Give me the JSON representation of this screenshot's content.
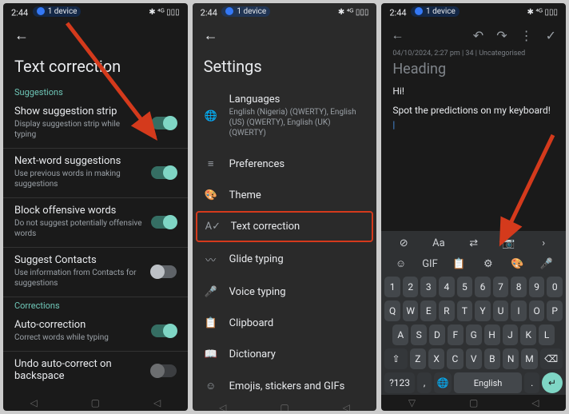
{
  "status": {
    "time": "2:44",
    "device": "1 device",
    "indicators": "✱ ⁴ᴳ ▯▯▯"
  },
  "panel1": {
    "title": "Text correction",
    "section_suggestions": "Suggestions",
    "section_corrections": "Corrections",
    "rows": {
      "strip": {
        "title": "Show suggestion strip",
        "sub": "Display suggestion strip while typing"
      },
      "next": {
        "title": "Next-word suggestions",
        "sub": "Use previous words in making suggestions"
      },
      "block": {
        "title": "Block offensive words",
        "sub": "Do not suggest potentially offensive words"
      },
      "contacts": {
        "title": "Suggest Contacts",
        "sub": "Use information from Contacts for suggestions"
      },
      "auto": {
        "title": "Auto-correction",
        "sub": "Correct words while typing"
      },
      "undo": {
        "title": "Undo auto-correct on backspace",
        "sub": ""
      }
    }
  },
  "panel2": {
    "title": "Settings",
    "items": {
      "languages": {
        "label": "Languages",
        "sub": "English (Nigeria) (QWERTY), English (US) (QWERTY), English (UK) (QWERTY)"
      },
      "preferences": {
        "label": "Preferences"
      },
      "theme": {
        "label": "Theme"
      },
      "textcorr": {
        "label": "Text correction"
      },
      "glide": {
        "label": "Glide typing"
      },
      "voice": {
        "label": "Voice typing"
      },
      "clipboard": {
        "label": "Clipboard"
      },
      "dictionary": {
        "label": "Dictionary"
      },
      "emoji": {
        "label": "Emojis, stickers and GIFs"
      }
    }
  },
  "panel3": {
    "meta": "04/10/2024, 2:27 pm  |  34  |  Uncategorised",
    "heading": "Heading",
    "line1": "Hi!",
    "line2": "Spot the predictions on my keyboard!",
    "keyboard": {
      "toolbar": {
        "gif": "GIF"
      },
      "space": "English",
      "symkey": "?123"
    }
  }
}
